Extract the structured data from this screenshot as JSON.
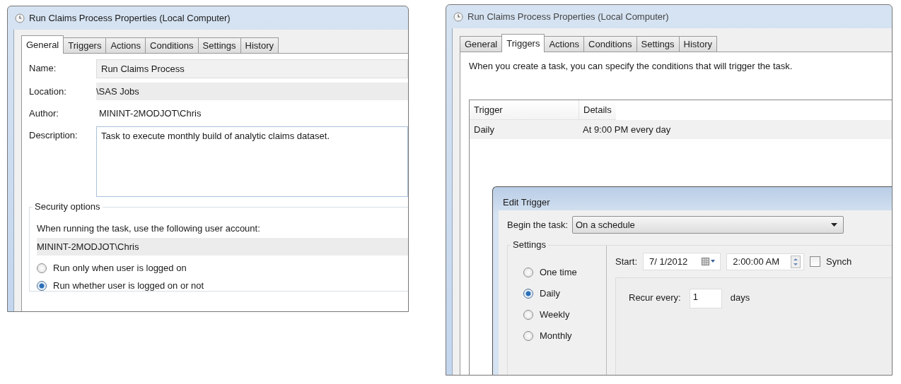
{
  "general_window": {
    "title": "Run Claims Process Properties (Local Computer)",
    "tabs": [
      {
        "label": "General",
        "selected": true
      },
      {
        "label": "Triggers",
        "selected": false
      },
      {
        "label": "Actions",
        "selected": false
      },
      {
        "label": "Conditions",
        "selected": false
      },
      {
        "label": "Settings",
        "selected": false
      },
      {
        "label": "History",
        "selected": false
      }
    ],
    "fields": [
      {
        "label": "Name:",
        "value": "Run Claims Process",
        "kind": "field"
      },
      {
        "label": "Location:",
        "value": "\\SAS Jobs",
        "kind": "readonly"
      },
      {
        "label": "Author:",
        "value": "MININT-2MODJOT\\Chris",
        "kind": "text"
      },
      {
        "label": "Description:",
        "value": "Task to execute monthly build of analytic claims dataset.",
        "kind": "multiline"
      }
    ],
    "security": {
      "legend": "Security options",
      "prompt": "When running the task, use the following user account:",
      "account": "MININT-2MODJOT\\Chris",
      "options": [
        {
          "label": "Run only when user is logged on",
          "selected": false
        },
        {
          "label": "Run whether user is logged on or not",
          "selected": true
        }
      ]
    }
  },
  "triggers_window": {
    "title": "Run Claims Process Properties (Local Computer)",
    "tabs": [
      {
        "label": "General",
        "selected": false
      },
      {
        "label": "Triggers",
        "selected": true
      },
      {
        "label": "Actions",
        "selected": false
      },
      {
        "label": "Conditions",
        "selected": false
      },
      {
        "label": "Settings",
        "selected": false
      },
      {
        "label": "History",
        "selected": false
      }
    ],
    "intro": "When you create a task, you can specify the conditions that will trigger the task.",
    "table": {
      "columns": [
        "Trigger",
        "Details"
      ],
      "rows": [
        [
          "Daily",
          "At 9:00 PM every day"
        ]
      ]
    },
    "edit_trigger": {
      "title": "Edit Trigger",
      "begin_label": "Begin the task:",
      "begin_value": "On a schedule",
      "settings_legend": "Settings",
      "schedule_options": [
        {
          "label": "One time",
          "selected": false
        },
        {
          "label": "Daily",
          "selected": true
        },
        {
          "label": "Weekly",
          "selected": false
        },
        {
          "label": "Monthly",
          "selected": false
        }
      ],
      "start_label": "Start:",
      "start_date": "7/ 1/2012",
      "start_time": "2:00:00 AM",
      "sync": {
        "label": "Synch",
        "checked": false
      },
      "recur_label": "Recur every:",
      "recur_value": "1",
      "recur_unit": "days"
    }
  }
}
